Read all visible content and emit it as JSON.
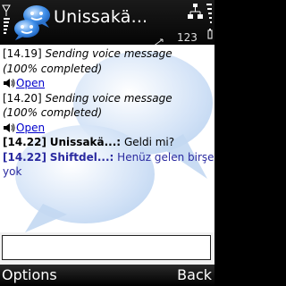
{
  "statusbar": {
    "title": "Unissakä...",
    "char_count": "123"
  },
  "messages": [
    {
      "time": "[14.19]",
      "text": "Sending voice message",
      "progress": "(100% completed)",
      "link": "Open"
    },
    {
      "time": "[14.20]",
      "text": "Sending voice message",
      "progress": "(100% completed)",
      "link": "Open"
    }
  ],
  "chat": [
    {
      "time": "[14.22]",
      "nick": "Unissakä...:",
      "text": "Geldi mi?"
    },
    {
      "time": "[14.22]",
      "nick": "Shiftdel...:",
      "text": "Henüz gelen birşey",
      "text_cont": "yok"
    }
  ],
  "input": {
    "value": ""
  },
  "softkeys": {
    "left": "Options",
    "right": "Back"
  },
  "colors": {
    "link": "#0000cc",
    "nick_b": "#2a2aa0",
    "background": "#ffffff"
  },
  "icons": [
    "signal-icon",
    "chat-logo-icon",
    "network-icon",
    "mode-icon",
    "battery-icon",
    "speaker-icon"
  ]
}
